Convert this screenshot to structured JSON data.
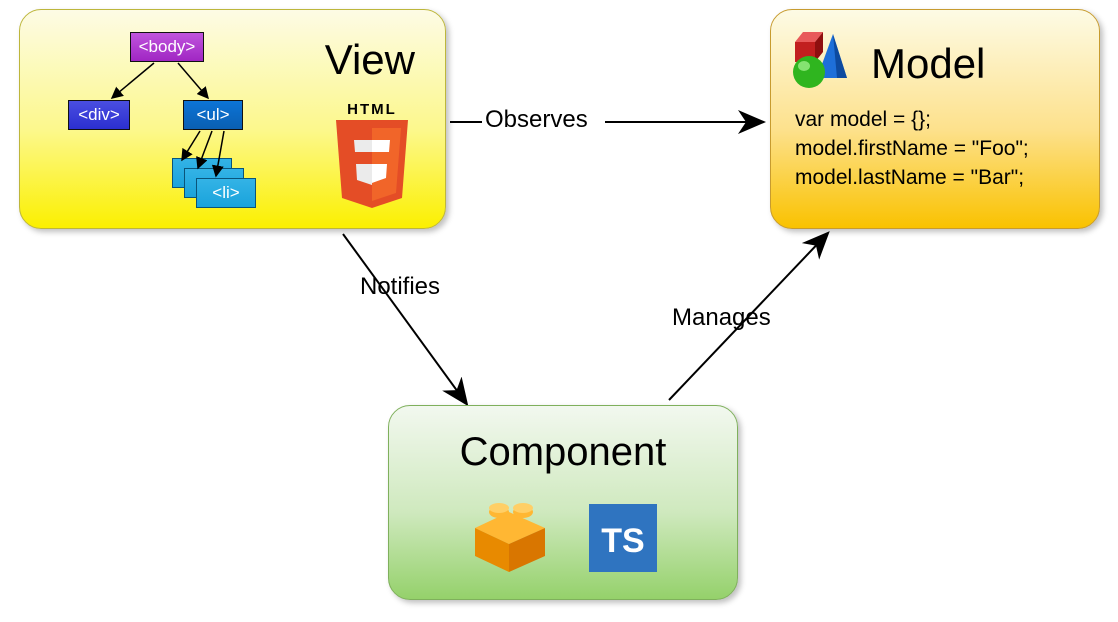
{
  "nodes": {
    "view": {
      "title": "View",
      "dom": {
        "body": "<body>",
        "div": "<div>",
        "ul": "<ul>",
        "li": "<li>"
      },
      "html5_label": "HTML"
    },
    "model": {
      "title": "Model",
      "code_line1": "var model = {};",
      "code_line2": "model.firstName = \"Foo\";",
      "code_line3": "model.lastName = \"Bar\";"
    },
    "component": {
      "title": "Component",
      "ts_label": "TS"
    }
  },
  "edges": {
    "observes": "Observes",
    "notifies": "Notifies",
    "manages": "Manages"
  }
}
